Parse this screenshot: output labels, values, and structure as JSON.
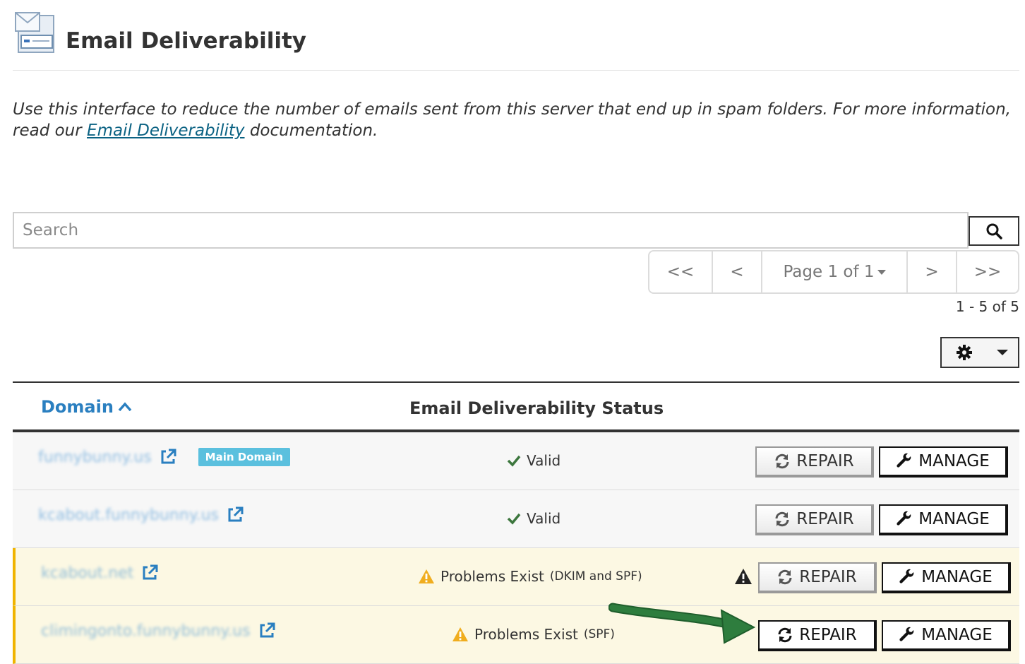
{
  "header": {
    "title": "Email Deliverability",
    "icon": "email-deliverability-icon"
  },
  "description": {
    "before": "Use this interface to reduce the number of emails sent from this server that end up in spam folders. For more information, read our ",
    "link": "Email Deliverability",
    "after": " documentation."
  },
  "search": {
    "placeholder": "Search",
    "value": ""
  },
  "pagination": {
    "first": "<<",
    "prev": "<",
    "page_label": "Page 1 of 1",
    "next": ">",
    "last": ">>"
  },
  "count_text": "1 - 5 of 5",
  "table": {
    "columns": {
      "domain": "Domain",
      "status": "Email Deliverability Status"
    },
    "repair_label": "REPAIR",
    "manage_label": "MANAGE",
    "rows": [
      {
        "domain": "funnybunny.us",
        "badge": "Main Domain",
        "status": "Valid",
        "status_detail": "",
        "state": "valid"
      },
      {
        "domain": "kcabout.funnybunny.us",
        "badge": "",
        "status": "Valid",
        "status_detail": "",
        "state": "valid"
      },
      {
        "domain": "kcabout.net",
        "badge": "",
        "status": "Problems Exist",
        "status_detail": "(DKIM and SPF)",
        "state": "warn"
      },
      {
        "domain": "climingonto.funnybunny.us",
        "badge": "",
        "status": "Problems Exist",
        "status_detail": "(SPF)",
        "state": "warn"
      }
    ]
  },
  "colors": {
    "link": "#0b6283",
    "domain": "#3a8dd0",
    "warn_bg": "#fcf8e3",
    "warn_border": "#f0b400",
    "valid_check": "#3c763d",
    "badge": "#5bc0de",
    "arrow": "#2e7d3e"
  }
}
